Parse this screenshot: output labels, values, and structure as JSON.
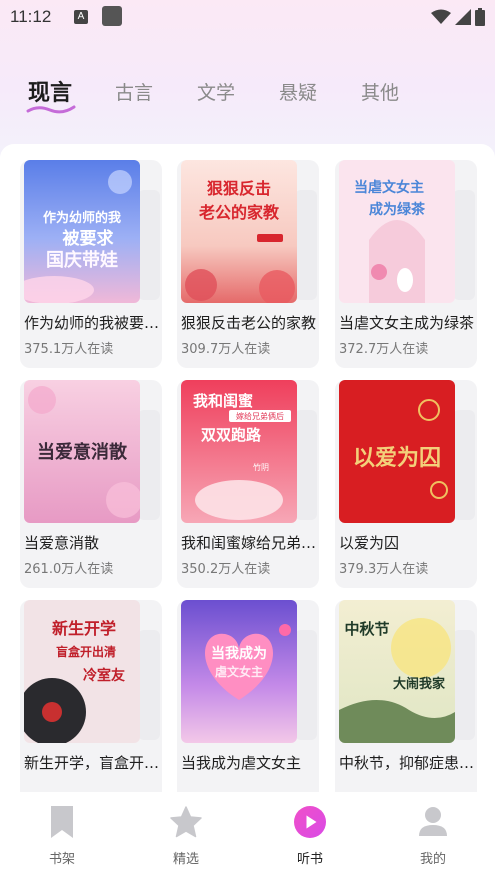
{
  "status_bar": {
    "time": "11:12",
    "notif_icon_letter": "A",
    "icons": [
      "wifi-icon",
      "signal-icon",
      "battery-icon"
    ]
  },
  "tabs": [
    {
      "label": "现言",
      "active": true
    },
    {
      "label": "古言",
      "active": false
    },
    {
      "label": "文学",
      "active": false
    },
    {
      "label": "悬疑",
      "active": false
    },
    {
      "label": "其他",
      "active": false
    }
  ],
  "books": [
    {
      "title": "作为幼师的我被要求国庆带娃",
      "readers": "375.1万人在读",
      "cover_text": [
        "作为幼师的我",
        "被要求",
        "国庆带娃"
      ]
    },
    {
      "title": "狠狠反击老公的家教",
      "readers": "309.7万人在读",
      "cover_text": [
        "狠狠反击",
        "老公的家教"
      ]
    },
    {
      "title": "当虐文女主成为绿茶",
      "readers": "372.7万人在读",
      "cover_text": [
        "当虐文女主",
        "成为绿茶"
      ]
    },
    {
      "title": "当爱意消散",
      "readers": "261.0万人在读",
      "cover_text": [
        "当爱意消散"
      ]
    },
    {
      "title": "我和闺蜜嫁给兄弟俩后双双跑路",
      "readers": "350.2万人在读",
      "cover_text": [
        "我和闺蜜",
        "嫁给兄弟俩后",
        "双双跑路",
        "竹阴"
      ]
    },
    {
      "title": "以爱为囚",
      "readers": "379.3万人在读",
      "cover_text": [
        "以爱为囚"
      ]
    },
    {
      "title": "新生开学，盲盒开出清冷校草室友",
      "readers": "",
      "cover_text": [
        "新生开学",
        "盲盒开出清",
        "冷室友"
      ]
    },
    {
      "title": "当我成为虐文女主",
      "readers": "",
      "cover_text": [
        "当我成为",
        "虐文女主"
      ]
    },
    {
      "title": "中秋节，抑郁症患者大闹我家",
      "readers": "",
      "cover_text": [
        "中秋节",
        "大闹我家"
      ]
    }
  ],
  "bottom_nav": [
    {
      "label": "书架",
      "icon": "bookmark-icon",
      "active": false
    },
    {
      "label": "精选",
      "icon": "star-icon",
      "active": false
    },
    {
      "label": "听书",
      "icon": "play-icon",
      "active": true
    },
    {
      "label": "我的",
      "icon": "user-icon",
      "active": false
    }
  ],
  "colors": {
    "accent": "#e24fd8",
    "tab_underline": "#c56bd8",
    "inactive_text": "#8a8a8a"
  }
}
